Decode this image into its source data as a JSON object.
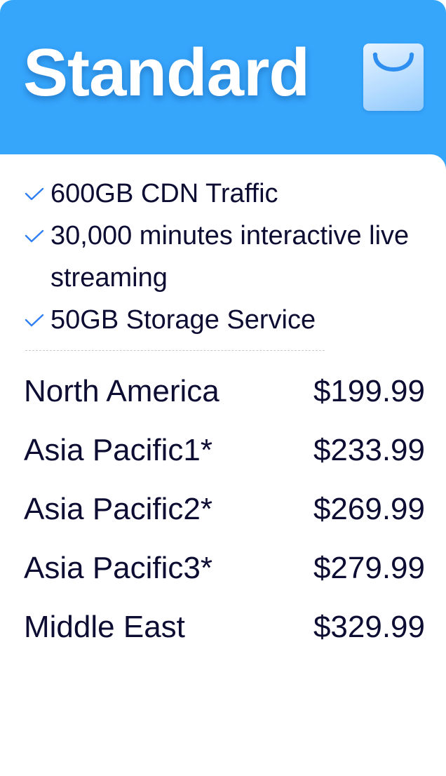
{
  "plan": {
    "title": "Standard",
    "icon": "shopping-bag-icon",
    "header_color": "#36a6fb"
  },
  "features": [
    {
      "icon": "check-icon",
      "text": "600GB CDN Traffic"
    },
    {
      "icon": "check-icon",
      "text": "30,000 minutes interactive live streaming"
    },
    {
      "icon": "check-icon",
      "text": "50GB Storage Service"
    }
  ],
  "prices": [
    {
      "region": "North America",
      "amount": "$199.99"
    },
    {
      "region": "Asia Pacific1*",
      "amount": "$233.99"
    },
    {
      "region": "Asia Pacific2*",
      "amount": "$269.99"
    },
    {
      "region": "Asia Pacific3*",
      "amount": "$279.99"
    },
    {
      "region": "Middle East",
      "amount": "$329.99"
    }
  ],
  "colors": {
    "accent": "#2f7ff5",
    "text": "#0d0d33"
  }
}
